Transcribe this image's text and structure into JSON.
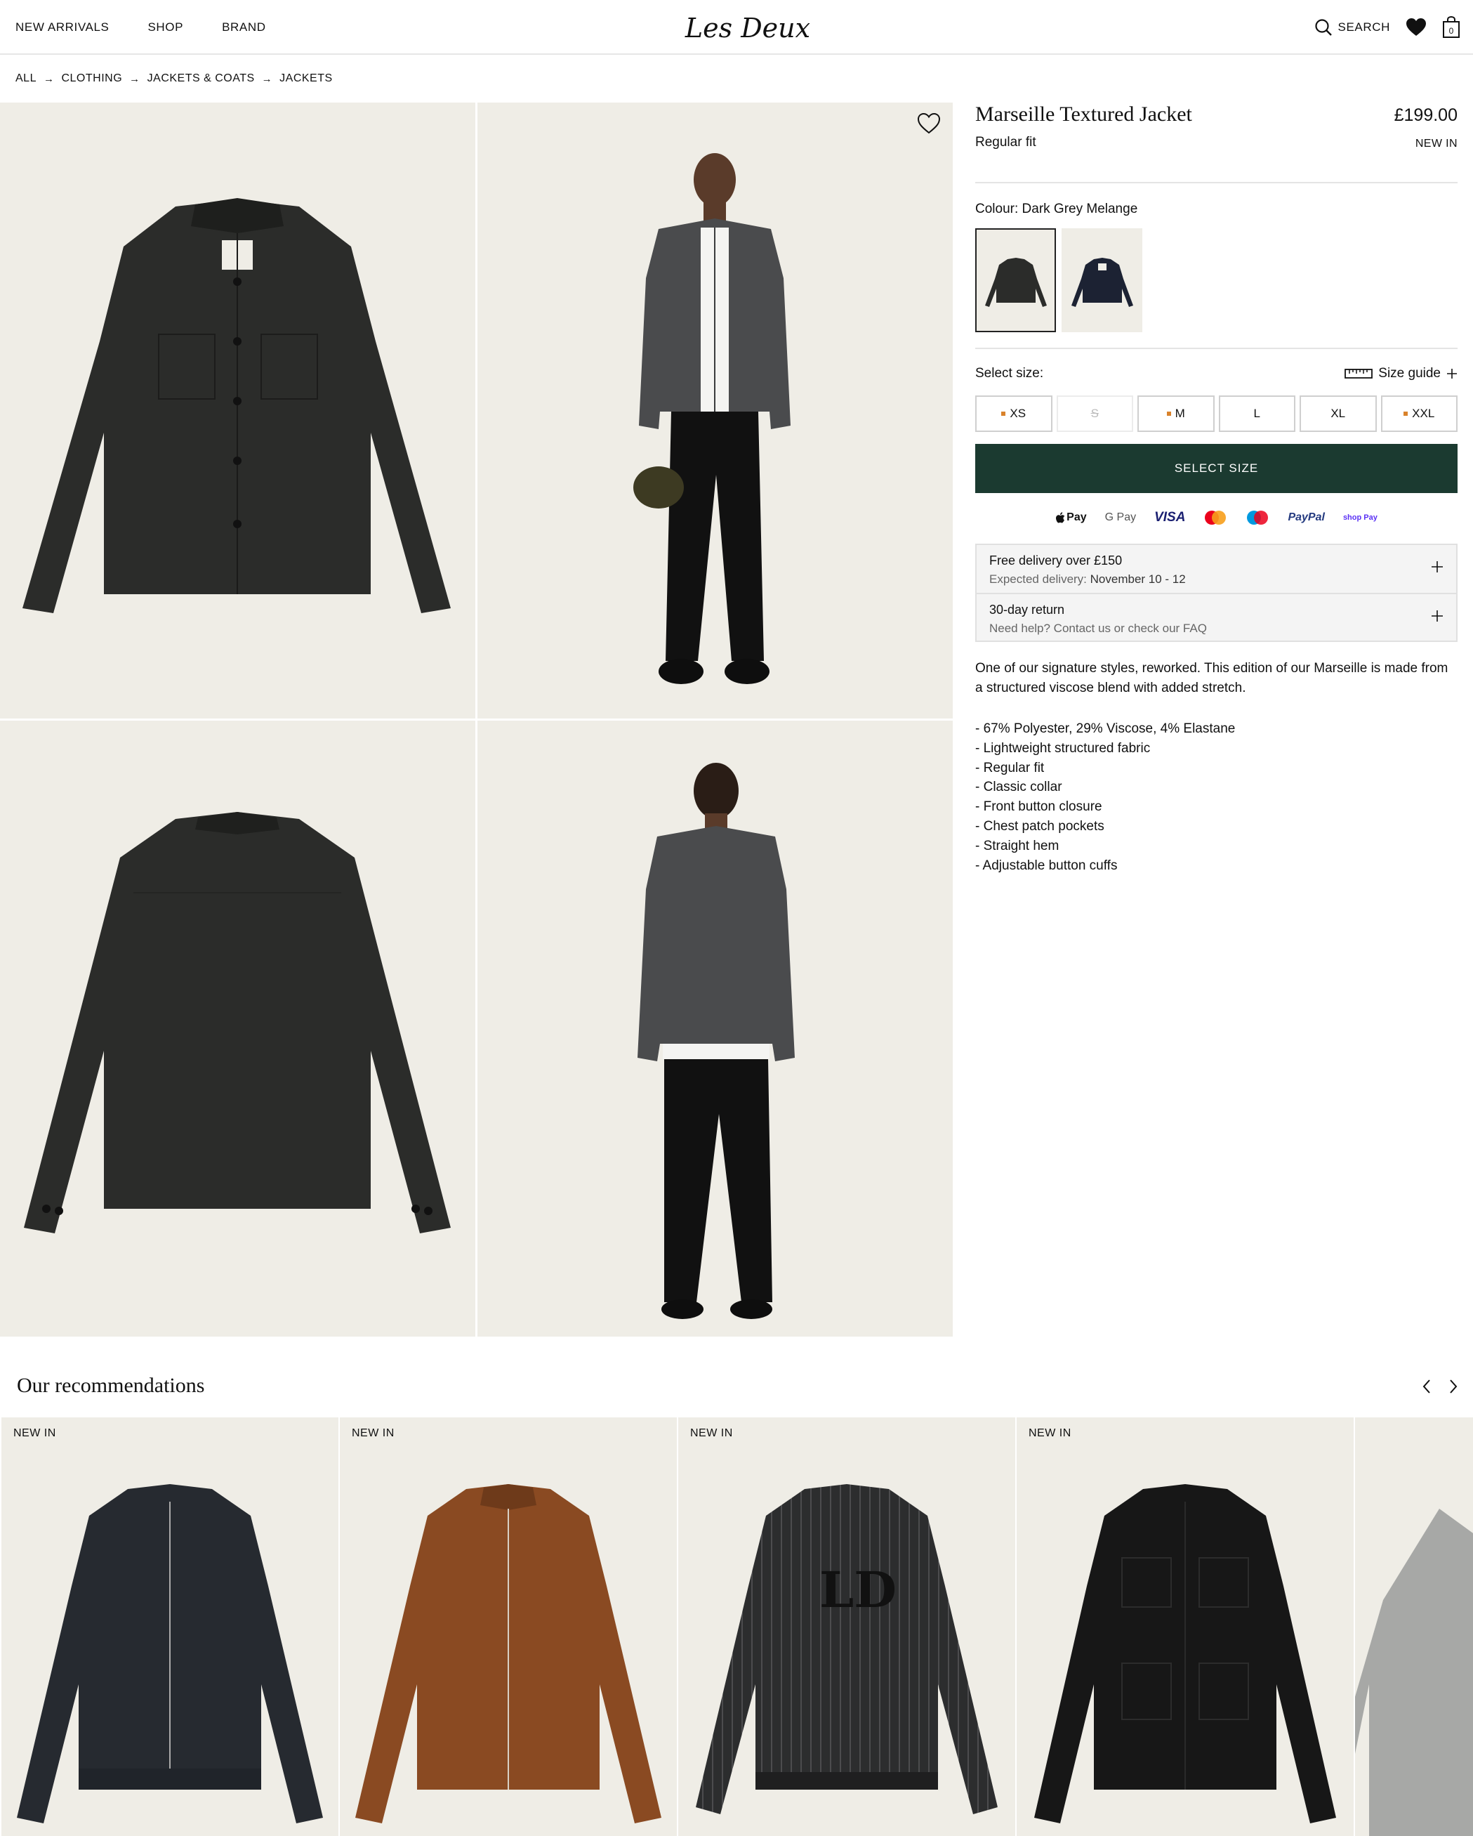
{
  "header": {
    "nav": [
      "NEW ARRIVALS",
      "SHOP",
      "BRAND"
    ],
    "logo_text": "Les Deux",
    "search_label": "SEARCH",
    "cart_count": "0"
  },
  "breadcrumb": [
    "ALL",
    "CLOTHING",
    "JACKETS & COATS",
    "JACKETS"
  ],
  "breadcrumb_sep": "→",
  "product": {
    "title": "Marseille Textured Jacket",
    "price": "£199.00",
    "fit": "Regular fit",
    "badge": "NEW IN",
    "colour_label": "Colour: Dark Grey Melange",
    "size_label": "Select size:",
    "size_guide": "Size guide",
    "sizes": [
      {
        "label": "XS",
        "low_stock": true,
        "available": true
      },
      {
        "label": "S",
        "low_stock": false,
        "available": false
      },
      {
        "label": "M",
        "low_stock": true,
        "available": true
      },
      {
        "label": "L",
        "low_stock": false,
        "available": true
      },
      {
        "label": "XL",
        "low_stock": false,
        "available": true
      },
      {
        "label": "XXL",
        "low_stock": true,
        "available": true
      }
    ],
    "cta": "SELECT SIZE",
    "payments": [
      "Pay",
      "G Pay",
      "VISA",
      "PayPal",
      "shop Pay"
    ],
    "delivery": {
      "title": "Free delivery over £150",
      "sub_prefix": "Expected delivery:",
      "sub_value": "November 10 - 12"
    },
    "returns": {
      "title": "30-day return",
      "sub": "Need help? Contact us or check our FAQ"
    },
    "description": "One of our signature styles, reworked. This edition of our Marseille is made from a structured viscose blend with added stretch.",
    "features": [
      "- 67% Polyester, 29% Viscose, 4% Elastane",
      "- Lightweight structured fabric",
      "- Regular fit",
      "- Classic collar",
      "- Front button closure",
      "- Chest patch pockets",
      "- Straight hem",
      "- Adjustable button cuffs"
    ]
  },
  "recommendations": {
    "title": "Our recommendations",
    "badge": "NEW IN"
  },
  "colors": {
    "cta_bg": "#1b3a30",
    "low_stock_dot": "#d9822b",
    "tile_bg": "#efede6"
  }
}
